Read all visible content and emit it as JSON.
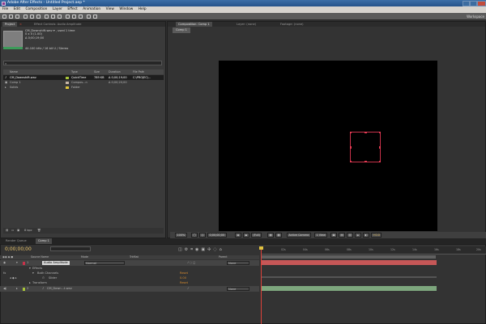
{
  "window": {
    "title": "Adobe After Effects - Untitled Project.aep *"
  },
  "menu": [
    "File",
    "Edit",
    "Composition",
    "Layer",
    "Effect",
    "Animation",
    "View",
    "Window",
    "Help"
  ],
  "toolbar": {
    "workspace": "Workspace"
  },
  "project_panel": {
    "tab_project": "Project",
    "tab_effects": "Effect Controls: Audio Amplitude",
    "info": {
      "name": "CM_Downshift.wav ▾ , used 1 time",
      "dims": "0 x 0 (1.00)",
      "duration": "Δ 0;00;19;00",
      "audio": "44.100 kHz / 16 bit U / Stereo"
    },
    "columns": {
      "name": "Name",
      "type": "Type",
      "size": "Size",
      "duration": "Duration",
      "filepath": "File Path"
    },
    "items": [
      {
        "name": "CM_Downshift.wav",
        "type": "QuickTime",
        "size": "789 KB",
        "duration": "Δ 0;00;19;00",
        "filepath": "C:\\PROJEC\\...",
        "color": "#a7c43a"
      },
      {
        "name": "Comp 1",
        "type": "Compos...n",
        "size": "",
        "duration": "Δ 0;00;20;00",
        "filepath": "",
        "color": "#c8b7a8"
      },
      {
        "name": "Solids",
        "type": "Folder",
        "size": "",
        "duration": "",
        "filepath": "",
        "color": "#e3c93a"
      }
    ],
    "bpc": "8 bpc"
  },
  "comp_panel": {
    "tab_comp": "Composition: Comp 1",
    "tab_layer": "Layer: (none)",
    "tab_footage": "Footage: (none)",
    "comp_tab": "Comp 1",
    "viewbar": {
      "zoom": "100%",
      "timecode": "0;00;00;00",
      "resolution": "(Full)",
      "camera": "Active Camera",
      "views": "1 View",
      "exposure": "+0.0"
    }
  },
  "timeline": {
    "tab_render": "Render Queue",
    "tab_comp": "Comp 1",
    "timecode": "0;00;00;00",
    "columns": {
      "source": "Source Name",
      "mode": "Mode",
      "trkmat": "TrkMat",
      "parent": "Parent"
    },
    "layers": [
      {
        "num": "1",
        "name": "Audio Amplitude",
        "mode": "Normal",
        "parent": "None"
      },
      {
        "num": "2",
        "name": "CM_Down...t.wav",
        "mode": "",
        "parent": "None"
      }
    ],
    "effects_label": "Effects",
    "effect_name": "Both Channels",
    "reset": "Reset",
    "slider_label": "Slider",
    "slider_value": "0.00",
    "transform_label": "Transform",
    "transform_reset": "Reset",
    "ruler": [
      "0s",
      "02s",
      "04s",
      "06s",
      "08s",
      "10s",
      "12s",
      "14s",
      "16s",
      "18s",
      "20s"
    ]
  }
}
